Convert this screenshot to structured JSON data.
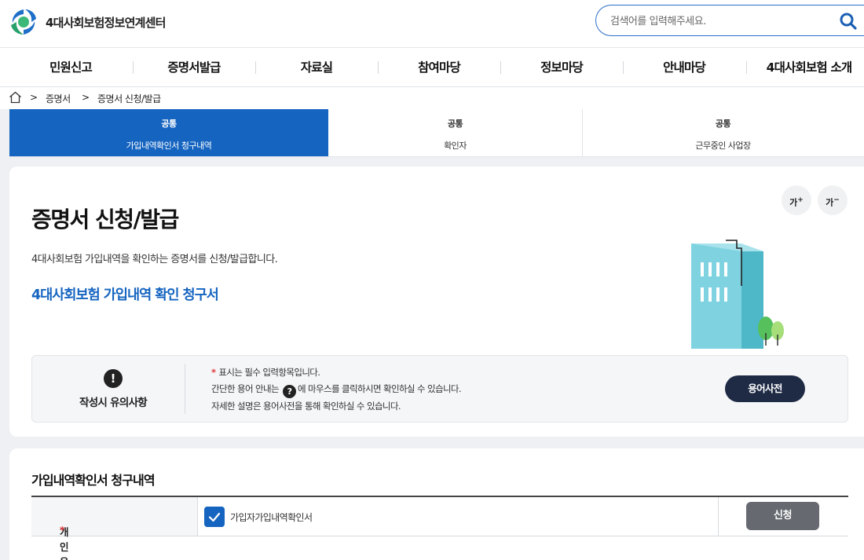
{
  "header": {
    "logo_text": "4대사회보험정보연계센터",
    "search_placeholder": "검색어를 입력해주세요."
  },
  "gnb": {
    "items": [
      "민원신고",
      "증명서발급",
      "자료실",
      "참여마당",
      "정보마당",
      "안내마당",
      "4대사회보험 소개"
    ]
  },
  "breadcrumb": {
    "separator": ">",
    "items": [
      "증명서",
      "증명서 신청/발급"
    ]
  },
  "tabs": [
    {
      "category": "공통",
      "label": "가입내역확인서 청구내역",
      "active": true
    },
    {
      "category": "공통",
      "label": "확인자",
      "active": false
    },
    {
      "category": "공통",
      "label": "근무중인 사업장",
      "active": false
    }
  ],
  "main": {
    "title": "증명서 신청/발급",
    "description": "4대사회보험 가입내역을 확인하는 증명서를 신청/발급합니다.",
    "form_title": "4대사회보험 가입내역 확인 청구서",
    "font_increase": "가",
    "font_decrease": "가",
    "font_increase_mark": "+",
    "font_decrease_mark": "−"
  },
  "notice": {
    "icon_glyph": "!",
    "title": "작성시 유의사항",
    "line1_star": "*",
    "line1": "표시는 필수 입력항목입니다.",
    "line2_before": "간단한 용어 안내는",
    "help_glyph": "?",
    "line2_after": "에 마우스를 클릭하시면 확인하실 수 있습니다.",
    "line3": "자세한 설명은 용어사전을 통해 확인하실 수 있습니다.",
    "dictionary_button": "용어사전"
  },
  "request_section": {
    "title": "가입내역확인서 청구내역",
    "row_label": "개인용",
    "required_mark": "*",
    "checkbox_label": "가입자가입내역확인서",
    "checked": true,
    "apply_button": "신청"
  },
  "colors": {
    "primary": "#1564c0",
    "dark_button": "#1f2b45",
    "gray_button": "#666a70",
    "required": "#e33b3b"
  },
  "icons": {
    "logo": "logo-mark-icon",
    "search": "search-icon",
    "home": "home-icon",
    "notice": "exclamation-icon",
    "help": "question-icon",
    "check": "check-icon",
    "illustration": "building-illustration"
  }
}
